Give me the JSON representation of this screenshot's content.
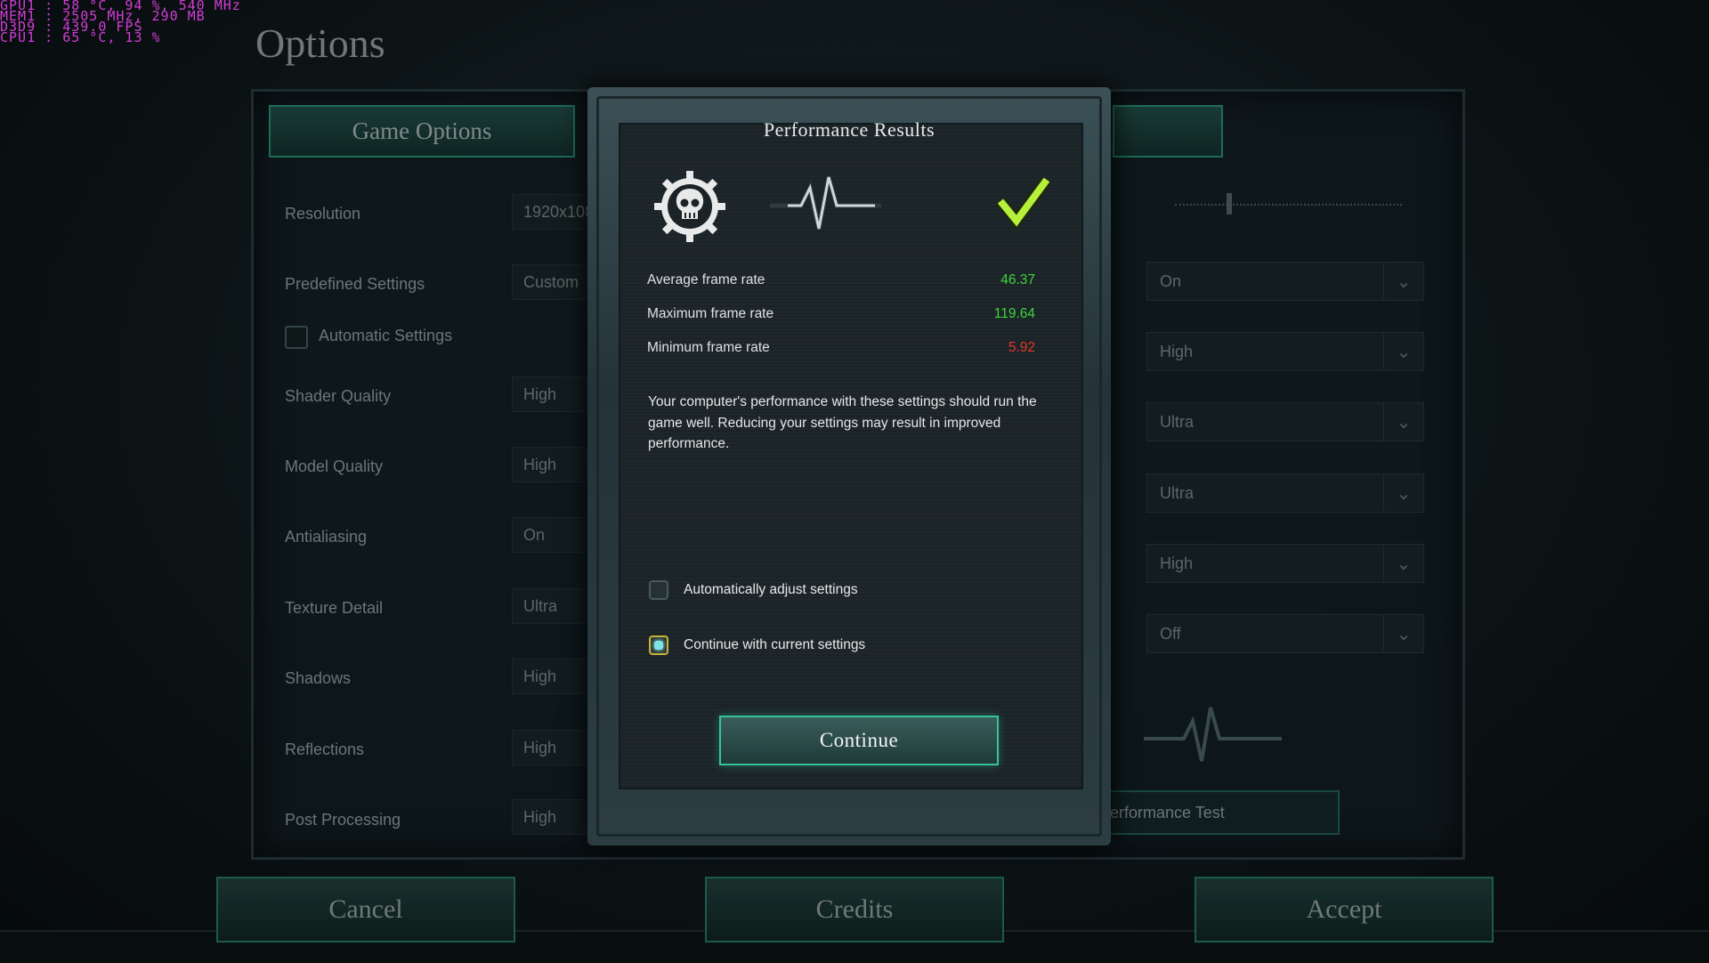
{
  "overlay": {
    "lines": [
      "GPU1  :  58 °C, 94 %, 540 MHz",
      "MEM1  :  2505 MHz, 290 MB",
      "D3D9  :  439.0 FPS",
      "CPU1  :  65 °C, 13 %"
    ],
    "color": "#d23cd6"
  },
  "page": {
    "title": "Options"
  },
  "tabs": {
    "left": "Game Options",
    "right": ""
  },
  "settings": [
    {
      "label": "Resolution",
      "value": "1920x108"
    },
    {
      "label": "Predefined Settings",
      "value": "Custom"
    },
    {
      "label": "Shader Quality",
      "value": "High"
    },
    {
      "label": "Model Quality",
      "value": "High"
    },
    {
      "label": "Antialiasing",
      "value": "On"
    },
    {
      "label": "Texture Detail",
      "value": "Ultra"
    },
    {
      "label": "Shadows",
      "value": "High"
    },
    {
      "label": "Reflections",
      "value": "High"
    },
    {
      "label": "Post Processing",
      "value": "High"
    }
  ],
  "automatic_settings": {
    "label": "Automatic Settings",
    "checked": false
  },
  "right_selects": [
    "On",
    "High",
    "Ultra",
    "Ultra",
    "High",
    "Off"
  ],
  "performance_test": {
    "label": "erformance Test"
  },
  "bottom_buttons": {
    "cancel": "Cancel",
    "credits": "Credits",
    "accept": "Accept"
  },
  "modal": {
    "title": "Performance Results",
    "icons": {
      "emblem": "skull-gear-icon",
      "pulse": "heartbeat-icon",
      "status": "checkmark-icon"
    },
    "stats": [
      {
        "label": "Average frame rate",
        "value": "46.37",
        "color": "#3fd43c"
      },
      {
        "label": "Maximum frame rate",
        "value": "119.64",
        "color": "#3fd43c"
      },
      {
        "label": "Minimum frame rate",
        "value": "5.92",
        "color": "#e0392c"
      }
    ],
    "description": "Your computer's performance with these settings should run the game well. Reducing your settings may result in improved performance.",
    "options": [
      {
        "label": "Automatically adjust settings",
        "selected": false
      },
      {
        "label": "Continue with current settings",
        "selected": true
      }
    ],
    "continue_label": "Continue"
  },
  "colors": {
    "accent": "#37c39c",
    "good": "#3fd43c",
    "bad": "#e0392c",
    "check": "#b7f03a"
  }
}
